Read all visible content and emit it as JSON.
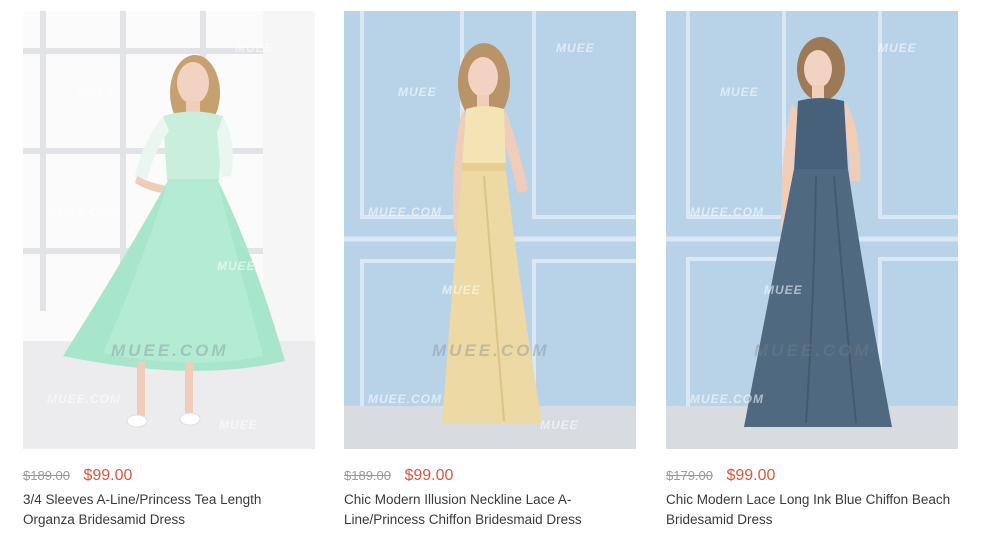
{
  "watermark": {
    "small": "MUEE",
    "domain_small": "MUEE.COM",
    "domain_big": "MUEE.COM"
  },
  "products": [
    {
      "old_price": "$189.00",
      "price": "$99.00",
      "title": "3/4 Sleeves A-Line/Princess Tea Length Organza Bridesamid Dress",
      "dress_color": "#a8e6cc"
    },
    {
      "old_price": "$189.00",
      "price": "$99.00",
      "title": "Chic Modern Illusion Neckline Lace A-Line/Princess Chiffon Bridesmaid Dress",
      "dress_color": "#ecd9a3"
    },
    {
      "old_price": "$179.00",
      "price": "$99.00",
      "title": "Chic Modern Lace Long Ink Blue Chiffon Beach Bridesamid Dress",
      "dress_color": "#4f6a80"
    }
  ]
}
